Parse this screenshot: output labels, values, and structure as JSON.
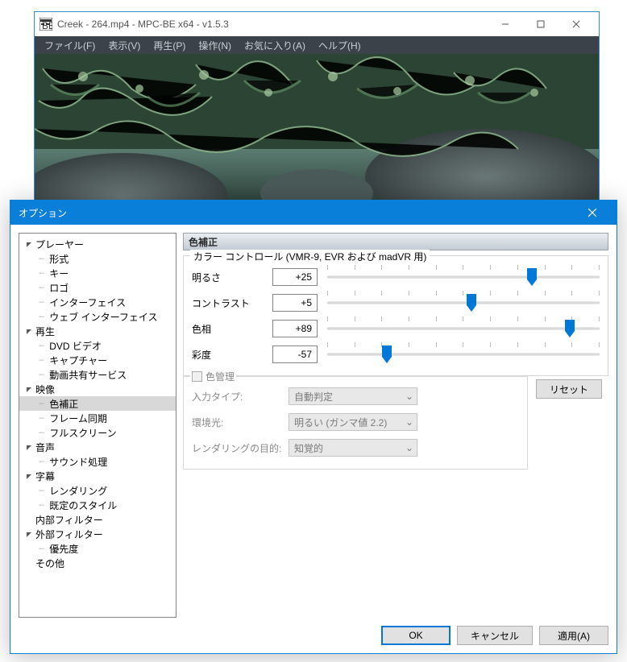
{
  "main_window": {
    "title": "Creek - 264.mp4 - MPC-BE x64 - v1.5.3",
    "menu": {
      "file": "ファイル(F)",
      "view": "表示(V)",
      "play": "再生(P)",
      "operate": "操作(N)",
      "favorites": "お気に入り(A)",
      "help": "ヘルプ(H)"
    }
  },
  "dialog": {
    "title": "オプション",
    "tree": {
      "player": {
        "label": "プレーヤー",
        "format": "形式",
        "key": "キー",
        "logo": "ロゴ",
        "interface": "インターフェイス",
        "web_interface": "ウェブ インターフェイス"
      },
      "playback": {
        "label": "再生",
        "dvd": "DVD ビデオ",
        "capture": "キャプチャー",
        "share": "動画共有サービス"
      },
      "video": {
        "label": "映像",
        "color": "色補正",
        "frame_sync": "フレーム同期",
        "fullscreen": "フルスクリーン"
      },
      "audio": {
        "label": "音声",
        "sound": "サウンド処理"
      },
      "subtitle": {
        "label": "字幕",
        "rendering": "レンダリング",
        "default_style": "既定のスタイル"
      },
      "internal_filter": "内部フィルター",
      "external_filter": {
        "label": "外部フィルター",
        "priority": "優先度"
      },
      "other": "その他"
    },
    "section_title": "色補正",
    "color_control_legend": "カラー コントロール (VMR-9, EVR および madVR 用)",
    "sliders": {
      "brightness": {
        "label": "明るさ",
        "value": "+25",
        "pos": 75
      },
      "contrast": {
        "label": "コントラスト",
        "value": "+5",
        "pos": 53
      },
      "hue": {
        "label": "色相",
        "value": "+89",
        "pos": 89
      },
      "saturation": {
        "label": "彩度",
        "value": "-57",
        "pos": 22
      }
    },
    "reset_btn": "リセット",
    "color_mgmt": {
      "legend": "色管理",
      "input_type_label": "入力タイプ:",
      "input_type_value": "自動判定",
      "ambient_label": "環境光:",
      "ambient_value": "明るい (ガンマ値 2.2)",
      "render_intent_label": "レンダリングの目的:",
      "render_intent_value": "知覚的"
    },
    "buttons": {
      "ok": "OK",
      "cancel": "キャンセル",
      "apply": "適用(A)"
    }
  }
}
